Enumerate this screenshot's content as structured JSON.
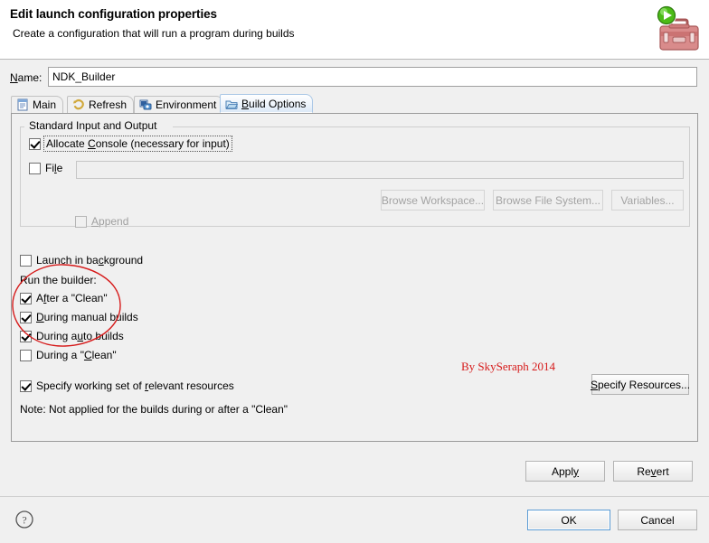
{
  "window": {
    "title": "Edit launch configuration properties",
    "subtitle": "Create a configuration that will run a program during builds",
    "icon": "launch-toolbox-icon"
  },
  "name_field": {
    "label": "Name:",
    "value": "NDK_Builder",
    "placeholder": ""
  },
  "tabs": [
    {
      "label": "Main",
      "icon": "main-document-icon",
      "selected": false
    },
    {
      "label": "Refresh",
      "icon": "refresh-icon",
      "selected": false
    },
    {
      "label": "Environment",
      "icon": "environment-icon",
      "selected": false
    },
    {
      "label": "Build Options",
      "icon": "build-options-folder-icon",
      "selected": true
    }
  ],
  "build_options": {
    "group_label": "Standard Input and Output",
    "allocate_console": {
      "label": "Allocate Console (necessary for input)",
      "checked": true,
      "focused": true
    },
    "file": {
      "label": "File",
      "checked": false,
      "value": "",
      "disabled": true
    },
    "browse_buttons": [
      {
        "label": "Browse Workspace...",
        "disabled": true
      },
      {
        "label": "Browse File System...",
        "disabled": true
      },
      {
        "label": "Variables...",
        "disabled": true
      }
    ],
    "append": {
      "label": "Append",
      "checked": false,
      "disabled": true
    },
    "launch_in_background": {
      "label": "Launch in background",
      "checked": false
    },
    "run_the_builder_label": "Run the builder:",
    "builder_options": [
      {
        "label": "After a \"Clean\"",
        "checked": true
      },
      {
        "label": "During manual builds",
        "checked": true
      },
      {
        "label": "During auto builds",
        "checked": true
      },
      {
        "label": "During a \"Clean\"",
        "checked": false
      }
    ],
    "specify_working_set": {
      "label": "Specify working set of relevant resources",
      "checked": true
    },
    "specify_resources_button": "Specify Resources...",
    "note": "Note: Not applied for the builds during or after a \"Clean\""
  },
  "footer": {
    "apply_label": "Apply",
    "revert_label": "Revert",
    "ok_label": "OK",
    "cancel_label": "Cancel",
    "help_icon": "help-question-icon"
  },
  "annotations": {
    "watermark": "By SkySeraph 2014",
    "watermark_color": "#d61a1a",
    "ellipse_color": "#d61a1a"
  }
}
